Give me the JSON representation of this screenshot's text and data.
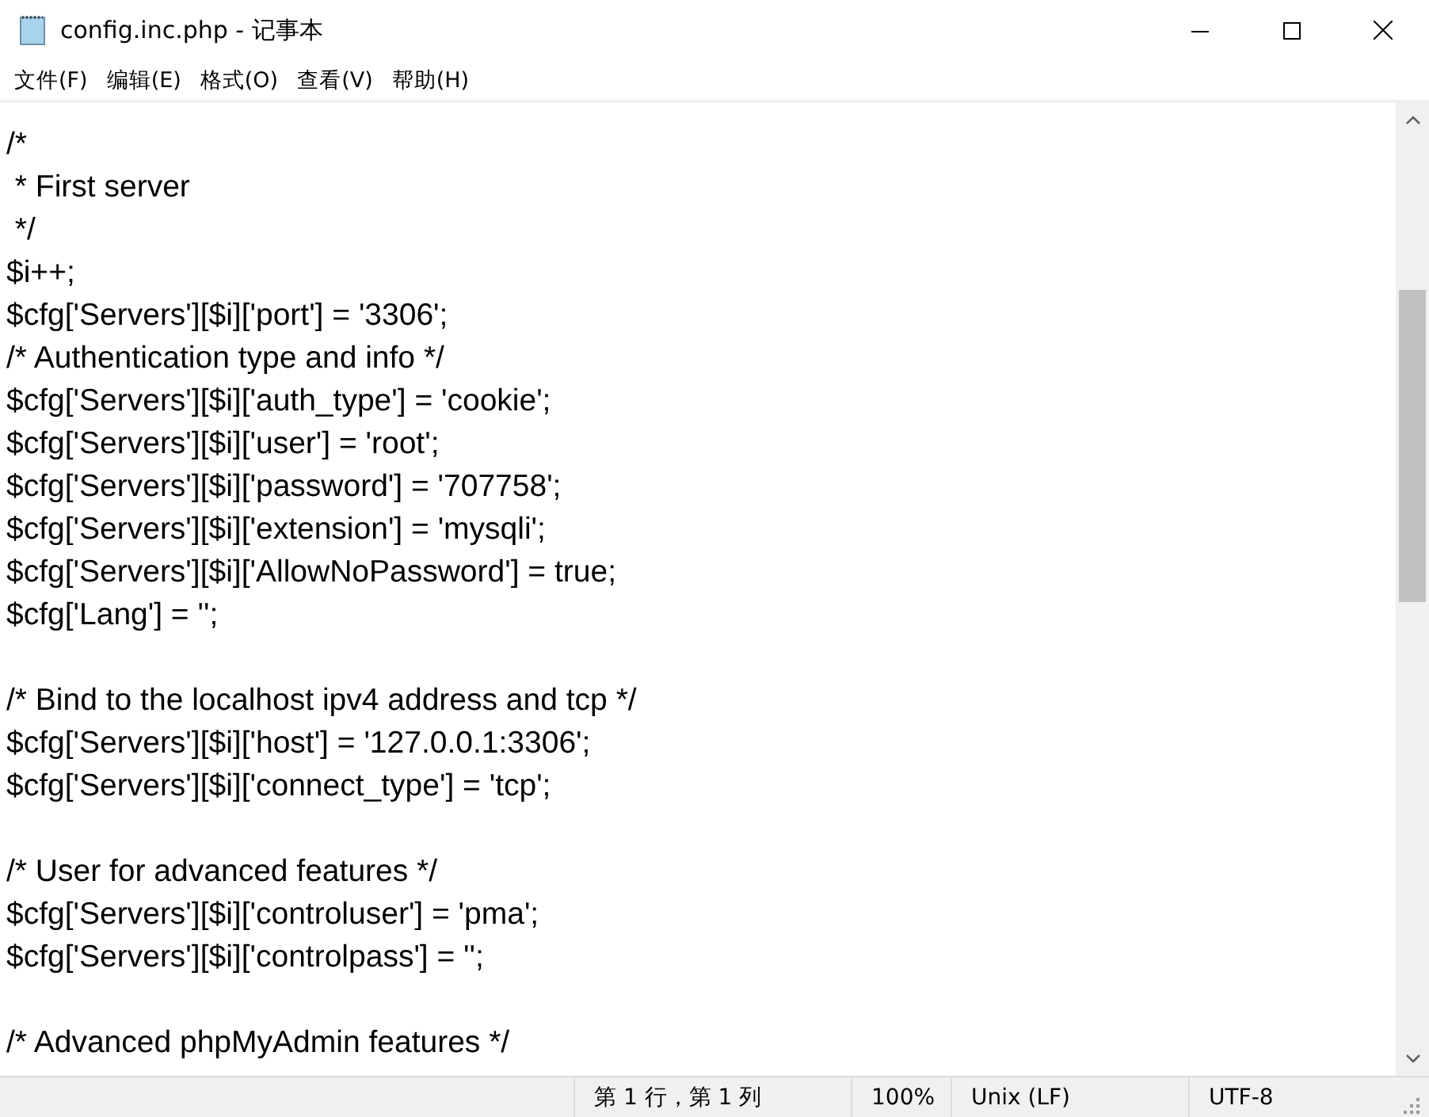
{
  "window": {
    "title": "config.inc.php - 记事本"
  },
  "menu": [
    {
      "label": "文件(F)"
    },
    {
      "label": "编辑(E)"
    },
    {
      "label": "格式(O)"
    },
    {
      "label": "查看(V)"
    },
    {
      "label": "帮助(H)"
    }
  ],
  "editor": {
    "blocks": [
      [
        "/*",
        " * First server",
        " */",
        "$i++;",
        "$cfg['Servers'][$i]['port'] = '3306';",
        "/* Authentication type and info */",
        "$cfg['Servers'][$i]['auth_type'] = 'cookie';",
        "$cfg['Servers'][$i]['user'] = 'root';",
        "$cfg['Servers'][$i]['password'] = '707758';",
        "$cfg['Servers'][$i]['extension'] = 'mysqli';",
        "$cfg['Servers'][$i]['AllowNoPassword'] = true;",
        "$cfg['Lang'] = '';"
      ],
      [
        "/* Bind to the localhost ipv4 address and tcp */",
        "$cfg['Servers'][$i]['host'] = '127.0.0.1:3306';",
        "$cfg['Servers'][$i]['connect_type'] = 'tcp';"
      ],
      [
        "/* User for advanced features */",
        "$cfg['Servers'][$i]['controluser'] = 'pma';",
        "$cfg['Servers'][$i]['controlpass'] = '';"
      ],
      [
        "/* Advanced phpMyAdmin features */"
      ]
    ]
  },
  "status_bar": {
    "position": "第 1 行，第 1 列",
    "zoom": "100%",
    "line_ending": "Unix (LF)",
    "encoding": "UTF-8"
  }
}
